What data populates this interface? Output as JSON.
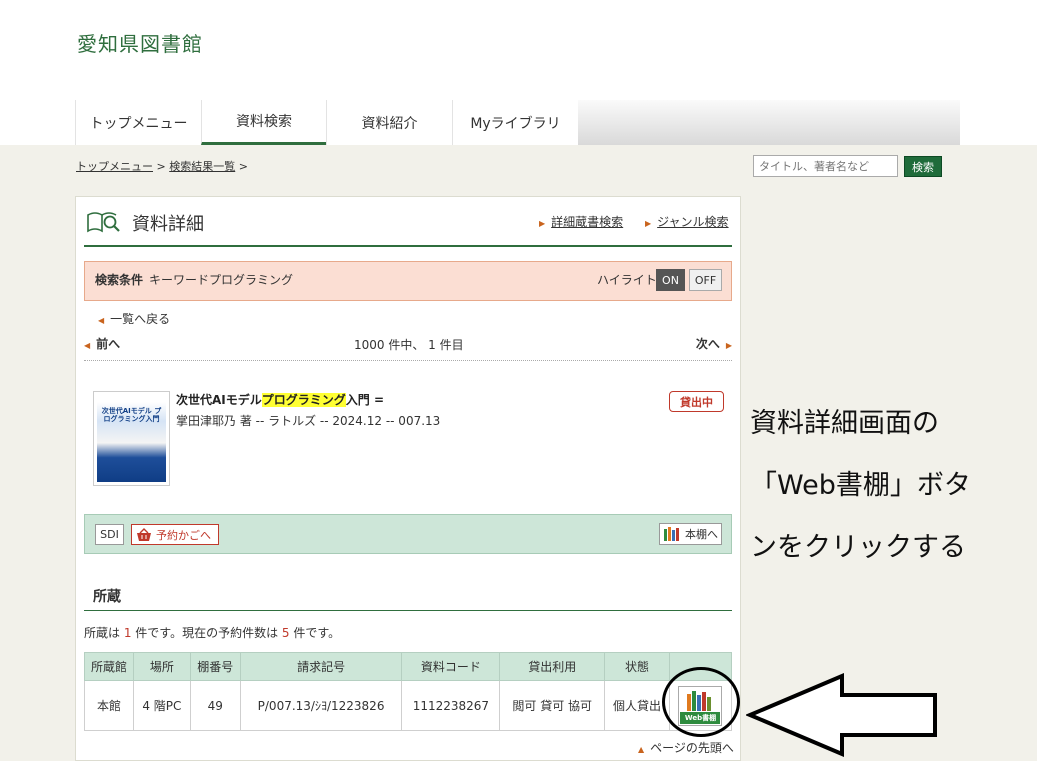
{
  "site": {
    "title": "愛知県図書館"
  },
  "nav": {
    "tabs": [
      {
        "label": "トップメニュー"
      },
      {
        "label": "資料検索"
      },
      {
        "label": "資料紹介"
      },
      {
        "label": "Myライブラリ"
      }
    ],
    "active_tab": "資料検索"
  },
  "breadcrumb": {
    "top": "トップメニュー",
    "sep": ">",
    "results": "検索結果一覧",
    "trail": ">"
  },
  "search": {
    "placeholder": "タイトル、著者名など",
    "button": "検索"
  },
  "detail": {
    "title": "資料詳細",
    "links": {
      "advanced": "詳細蔵書検索",
      "genre": "ジャンル検索"
    },
    "condition": {
      "label": "検索条件",
      "text": "キーワードプログラミング",
      "highlight_label": "ハイライト",
      "on": "ON",
      "off": "OFF"
    },
    "back": "一覧へ戻る",
    "pager": {
      "prev": "前へ",
      "count": "1000 件中、 1 件目",
      "next": "次へ"
    },
    "book": {
      "title_before": "次世代AIモデル",
      "title_highlight": "プログラミング",
      "title_after": "入門 =",
      "meta": "掌田津耶乃 著 -- ラトルズ -- 2024.12 -- 007.13",
      "status": "貸出中",
      "cover_text": "次世代AIモデル プログラミング入門"
    },
    "actions": {
      "sdi": "SDI",
      "cart": "予約かごへ",
      "shelf": "本棚へ"
    },
    "holdings": {
      "section_title": "所蔵",
      "summary_a": "所蔵は ",
      "summary_count": "1",
      "summary_b": " 件です。現在の予約件数は ",
      "summary_reserve": "5",
      "summary_c": " 件です。",
      "headers": [
        "所蔵館",
        "場所",
        "棚番号",
        "請求記号",
        "資料コード",
        "貸出利用",
        "状態",
        ""
      ],
      "row": [
        "本館",
        "4 階PC",
        "49",
        "P/007.13/ｼﾖ/1223826",
        "1112238267",
        "閲可 貸可 協可",
        "個人貸出"
      ],
      "web_shelf": "Web書棚"
    },
    "page_top": "ページの先頭へ"
  },
  "annotation": {
    "line1": "資料詳細画面の",
    "line2": "「Web書棚」ボタ",
    "line3": "ンをクリックする"
  },
  "colors": {
    "brand_green": "#2f6e3e",
    "condition_bg": "#fbded3",
    "accent_orange": "#c9641e",
    "status_red": "#c0392b"
  }
}
